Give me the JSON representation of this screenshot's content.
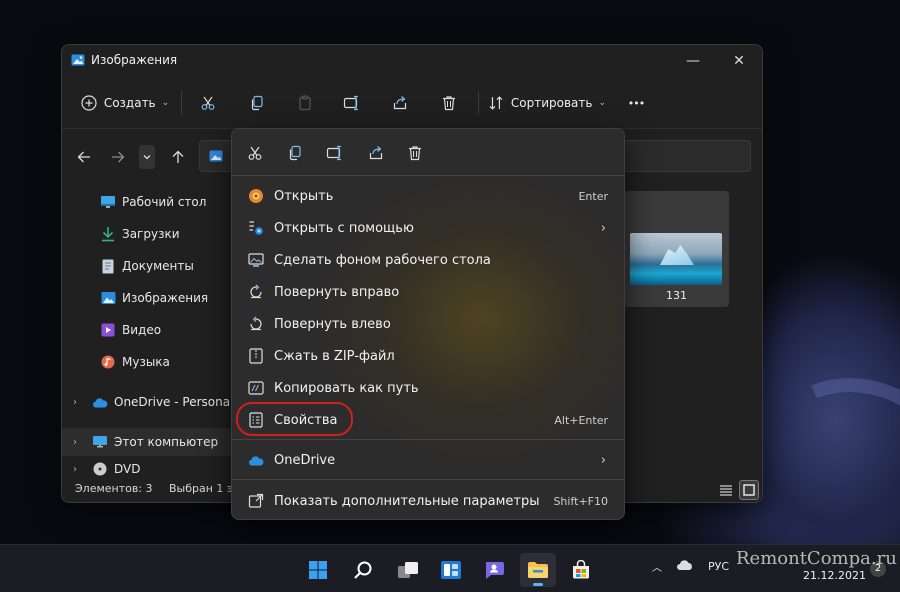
{
  "window": {
    "title": "Изображения",
    "controls": {
      "minimize": "—",
      "maximize": "☐",
      "close": "✕"
    }
  },
  "toolbar": {
    "create_label": "Создать",
    "sort_label": "Сортировать",
    "more_label": "•••"
  },
  "sidebar": {
    "items": [
      {
        "label": "Рабочий стол",
        "icon": "desktop-icon"
      },
      {
        "label": "Загрузки",
        "icon": "download-icon"
      },
      {
        "label": "Документы",
        "icon": "document-icon"
      },
      {
        "label": "Изображения",
        "icon": "pictures-icon"
      },
      {
        "label": "Видео",
        "icon": "video-icon"
      },
      {
        "label": "Музыка",
        "icon": "music-icon"
      },
      {
        "label": "OneDrive - Personal",
        "icon": "onedrive-icon"
      },
      {
        "label": "Этот компьютер",
        "icon": "computer-icon"
      },
      {
        "label": "DVD",
        "icon": "dvd-icon"
      }
    ]
  },
  "content": {
    "thumbnail_label": "131"
  },
  "status": {
    "items_count": "Элементов: 3",
    "selected": "Выбран 1 э"
  },
  "context_menu": {
    "items": [
      {
        "label": "Открыть",
        "shortcut": "Enter",
        "icon": "open-app-icon"
      },
      {
        "label": "Открыть с помощью",
        "shortcut": "",
        "icon": "open-with-icon",
        "submenu": true
      },
      {
        "label": "Сделать фоном рабочего стола",
        "shortcut": "",
        "icon": "wallpaper-icon"
      },
      {
        "label": "Повернуть вправо",
        "shortcut": "",
        "icon": "rotate-right-icon"
      },
      {
        "label": "Повернуть влево",
        "shortcut": "",
        "icon": "rotate-left-icon"
      },
      {
        "label": "Сжать в ZIP-файл",
        "shortcut": "",
        "icon": "zip-icon"
      },
      {
        "label": "Копировать как путь",
        "shortcut": "",
        "icon": "copy-path-icon"
      },
      {
        "label": "Свойства",
        "shortcut": "Alt+Enter",
        "icon": "properties-icon"
      },
      {
        "label": "OneDrive",
        "shortcut": "",
        "icon": "onedrive-icon",
        "submenu": true
      },
      {
        "label": "Показать дополнительные параметры",
        "shortcut": "Shift+F10",
        "icon": "more-options-icon"
      }
    ],
    "submenu_arrow": "›"
  },
  "taskbar": {
    "language": "РУС",
    "date": "21.12.2021",
    "notifications": "2",
    "watermark": "RemontCompa.ru"
  },
  "colors": {
    "accent": "#5fb2f2",
    "highlight_ring": "#d31f1f",
    "menu_bg": "#2c2c2c",
    "window_bg": "#202020"
  }
}
